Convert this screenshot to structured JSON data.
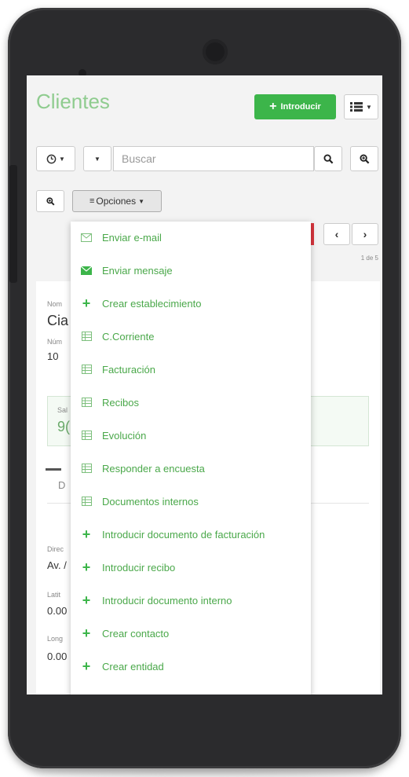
{
  "page": {
    "title": "Clientes"
  },
  "header": {
    "introducir_label": "Introducir"
  },
  "search": {
    "placeholder": "Buscar"
  },
  "options": {
    "label": "Opciones"
  },
  "pagination": {
    "text": "1 de 5"
  },
  "record": {
    "name_label": "Nom",
    "name_value": "Cia",
    "number_label": "Núm",
    "number_value": "10",
    "saldo_label": "Sal",
    "saldo_value": "9(",
    "tab_label": "D",
    "address_label": "Direc",
    "address_value": "Av. /",
    "lat_label": "Latit",
    "lat_value": "0.00",
    "lng_label": "Long",
    "lng_value": "0.00"
  },
  "menu": {
    "items": [
      {
        "label": "Enviar e-mail",
        "icon": "envelope-outline-icon"
      },
      {
        "label": "Enviar mensaje",
        "icon": "envelope-filled-icon"
      },
      {
        "label": "Crear establecimiento",
        "icon": "plus-icon"
      },
      {
        "label": "C.Corriente",
        "icon": "table-icon"
      },
      {
        "label": "Facturación",
        "icon": "table-icon"
      },
      {
        "label": "Recibos",
        "icon": "table-icon"
      },
      {
        "label": "Evolución",
        "icon": "table-icon"
      },
      {
        "label": "Responder a encuesta",
        "icon": "table-icon"
      },
      {
        "label": "Documentos internos",
        "icon": "table-icon"
      },
      {
        "label": "Introducir documento de facturación",
        "icon": "plus-icon"
      },
      {
        "label": "Introducir recibo",
        "icon": "plus-icon"
      },
      {
        "label": "Introducir documento interno",
        "icon": "plus-icon"
      },
      {
        "label": "Crear contacto",
        "icon": "plus-icon"
      },
      {
        "label": "Crear entidad",
        "icon": "plus-icon"
      }
    ]
  },
  "colors": {
    "accent": "#3cb54a",
    "title": "#8fcc8f",
    "menu_text": "#4aa84a",
    "marker": "#d9363e"
  }
}
